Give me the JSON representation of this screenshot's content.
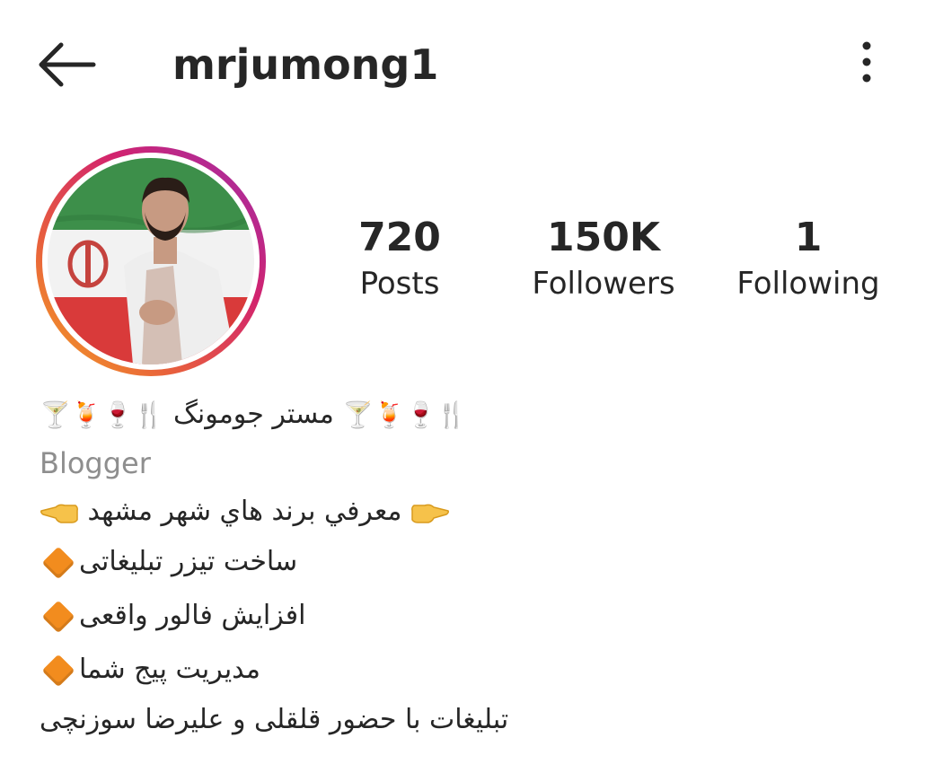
{
  "header": {
    "username": "mrjumong1",
    "back_icon": "arrow-left-icon",
    "more_icon": "more-vertical-icon"
  },
  "profile": {
    "avatar_description": "profile-photo",
    "stats": {
      "posts_count": "720",
      "posts_label": "Posts",
      "followers_count": "150K",
      "followers_label": "Followers",
      "following_count": "1",
      "following_label": "Following"
    }
  },
  "bio": {
    "name_text": "مستر جومونگ",
    "name_emoji_left": "🍸🍹🍷🍴",
    "name_emoji_right": "🍸🍹🍷🍴",
    "category": "Blogger",
    "line1": "معرفي برند هاي شهر مشهد",
    "line2": "ساخت تیزر تبلیغاتی",
    "line3": "افزایش فالور واقعی",
    "line4": "مدیریت پیج شما",
    "line5": "تبلیغات با حضور قلقلی و علیرضا سوزنچی"
  },
  "colors": {
    "text": "#262626",
    "secondary_text": "#8e8e8e",
    "ring_start": "#f5a623",
    "ring_end": "#9b2fae",
    "diamond": "#f28c1e"
  }
}
